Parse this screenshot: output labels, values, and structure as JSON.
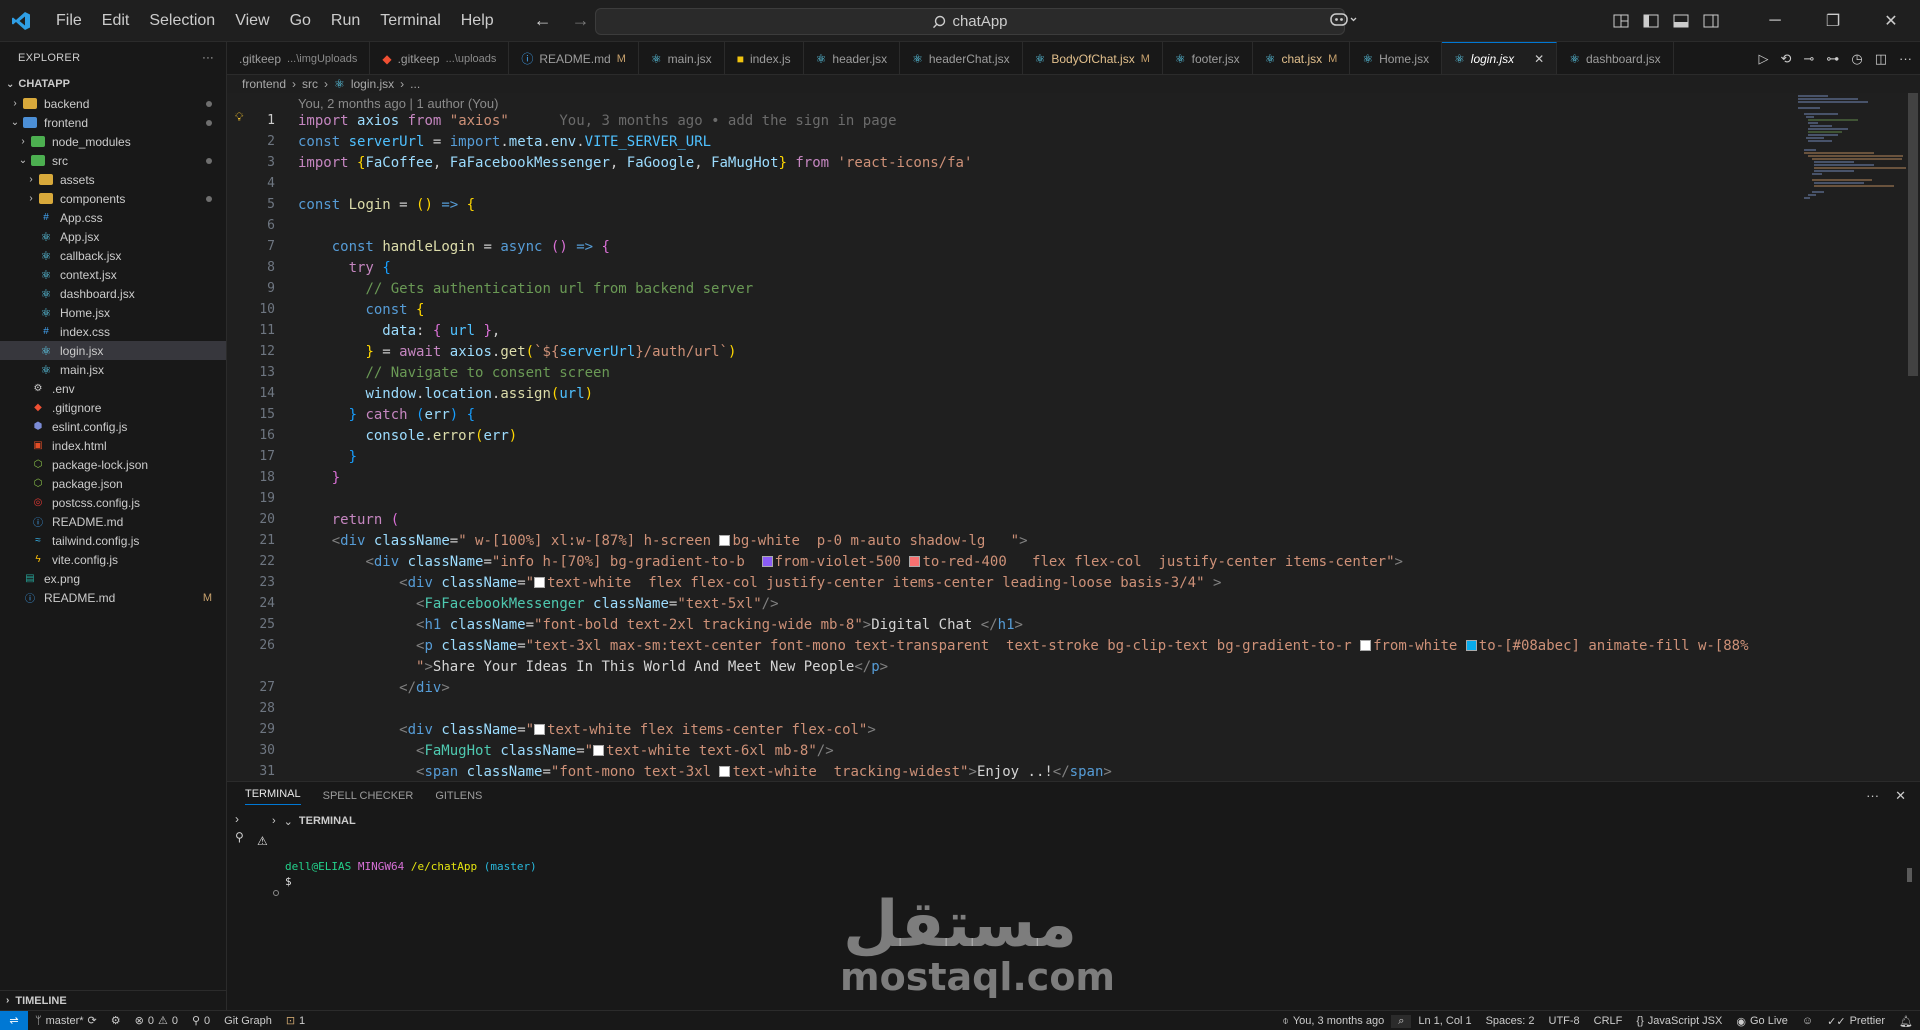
{
  "titlebar": {
    "menu": [
      "File",
      "Edit",
      "Selection",
      "View",
      "Go",
      "Run",
      "Terminal",
      "Help"
    ],
    "search": "chatApp"
  },
  "sidebar": {
    "header": "EXPLORER",
    "section": "CHATAPP",
    "items": [
      {
        "label": "backend",
        "kind": "folder",
        "depth": 0,
        "open": false,
        "dot": true
      },
      {
        "label": "frontend",
        "kind": "folder-blue",
        "depth": 0,
        "open": true,
        "dot": true
      },
      {
        "label": "node_modules",
        "kind": "folder-green",
        "depth": 1,
        "open": false
      },
      {
        "label": "src",
        "kind": "folder-green",
        "depth": 1,
        "open": true,
        "dot": true
      },
      {
        "label": "assets",
        "kind": "folder",
        "depth": 2,
        "open": false
      },
      {
        "label": "components",
        "kind": "folder",
        "depth": 2,
        "open": false,
        "dot": true
      },
      {
        "label": "App.css",
        "kind": "css",
        "depth": 2
      },
      {
        "label": "App.jsx",
        "kind": "react",
        "depth": 2
      },
      {
        "label": "callback.jsx",
        "kind": "react",
        "depth": 2
      },
      {
        "label": "context.jsx",
        "kind": "react",
        "depth": 2
      },
      {
        "label": "dashboard.jsx",
        "kind": "react",
        "depth": 2
      },
      {
        "label": "Home.jsx",
        "kind": "react",
        "depth": 2
      },
      {
        "label": "index.css",
        "kind": "css",
        "depth": 2
      },
      {
        "label": "login.jsx",
        "kind": "react",
        "depth": 2,
        "active": true
      },
      {
        "label": "main.jsx",
        "kind": "react",
        "depth": 2
      },
      {
        "label": ".env",
        "kind": "env",
        "depth": 1
      },
      {
        "label": ".gitignore",
        "kind": "git",
        "depth": 1
      },
      {
        "label": "eslint.config.js",
        "kind": "eslint",
        "depth": 1
      },
      {
        "label": "index.html",
        "kind": "html",
        "depth": 1
      },
      {
        "label": "package-lock.json",
        "kind": "npm",
        "depth": 1
      },
      {
        "label": "package.json",
        "kind": "npm",
        "depth": 1
      },
      {
        "label": "postcss.config.js",
        "kind": "postcss",
        "depth": 1
      },
      {
        "label": "README.md",
        "kind": "info",
        "depth": 1
      },
      {
        "label": "tailwind.config.js",
        "kind": "tailwind",
        "depth": 1
      },
      {
        "label": "vite.config.js",
        "kind": "vite",
        "depth": 1
      },
      {
        "label": "ex.png",
        "kind": "image",
        "depth": 0
      },
      {
        "label": "README.md",
        "kind": "info",
        "depth": 0,
        "modified": "M"
      }
    ],
    "timeline": "TIMELINE"
  },
  "tabs": [
    {
      "label": ".gitkeep",
      "sub": "...\\imgUploads",
      "icon": "none"
    },
    {
      "label": ".gitkeep",
      "sub": "...\\uploads",
      "icon": "git"
    },
    {
      "label": "README.md",
      "mod": "M",
      "icon": "info"
    },
    {
      "label": "main.jsx",
      "icon": "react"
    },
    {
      "label": "index.js",
      "icon": "js"
    },
    {
      "label": "header.jsx",
      "icon": "react"
    },
    {
      "label": "headerChat.jsx",
      "icon": "react"
    },
    {
      "label": "BodyOfChat.jsx",
      "mod": "M",
      "icon": "react",
      "warn": true
    },
    {
      "label": "footer.jsx",
      "icon": "react"
    },
    {
      "label": "chat.jsx",
      "mod": "M",
      "icon": "react",
      "warn": true
    },
    {
      "label": "Home.jsx",
      "icon": "react"
    },
    {
      "label": "login.jsx",
      "icon": "react",
      "active": true
    },
    {
      "label": "dashboard.jsx",
      "icon": "react"
    }
  ],
  "breadcrumb": [
    "frontend",
    "src",
    "login.jsx",
    "..."
  ],
  "editor": {
    "blame_header": "You, 2 months ago | 1 author (You)",
    "inline_blame": "You, 3 months ago • add the sign in page",
    "line_numbers": [
      "1",
      "2",
      "3",
      "4",
      "5",
      "6",
      "7",
      "8",
      "9",
      "10",
      "11",
      "12",
      "13",
      "14",
      "15",
      "16",
      "17",
      "18",
      "19",
      "20",
      "21",
      "22",
      "23",
      "24",
      "25",
      "26",
      "",
      "27",
      "28",
      "29",
      "30",
      "31"
    ]
  },
  "panel": {
    "tabs": [
      "TERMINAL",
      "SPELL CHECKER",
      "GITLENS"
    ],
    "terminal_title": "TERMINAL",
    "prompt_user": "dell@ELIAS",
    "prompt_host": "MINGW64",
    "prompt_path": "/e/chatApp",
    "prompt_branch": "(master)",
    "prompt_symbol": "$"
  },
  "watermark": {
    "arabic": "مستقل",
    "latin": "mostaql.com"
  },
  "statusbar": {
    "branch": "master*",
    "errors": "0",
    "warnings": "0",
    "ports": "0",
    "git_graph": "Git Graph",
    "counter": "1",
    "blame": "You, 3 months ago",
    "position": "Ln 1, Col 1",
    "spaces": "Spaces: 2",
    "encoding": "UTF-8",
    "eol": "CRLF",
    "language": "JavaScript JSX",
    "golive": "Go Live",
    "prettier": "Prettier"
  }
}
